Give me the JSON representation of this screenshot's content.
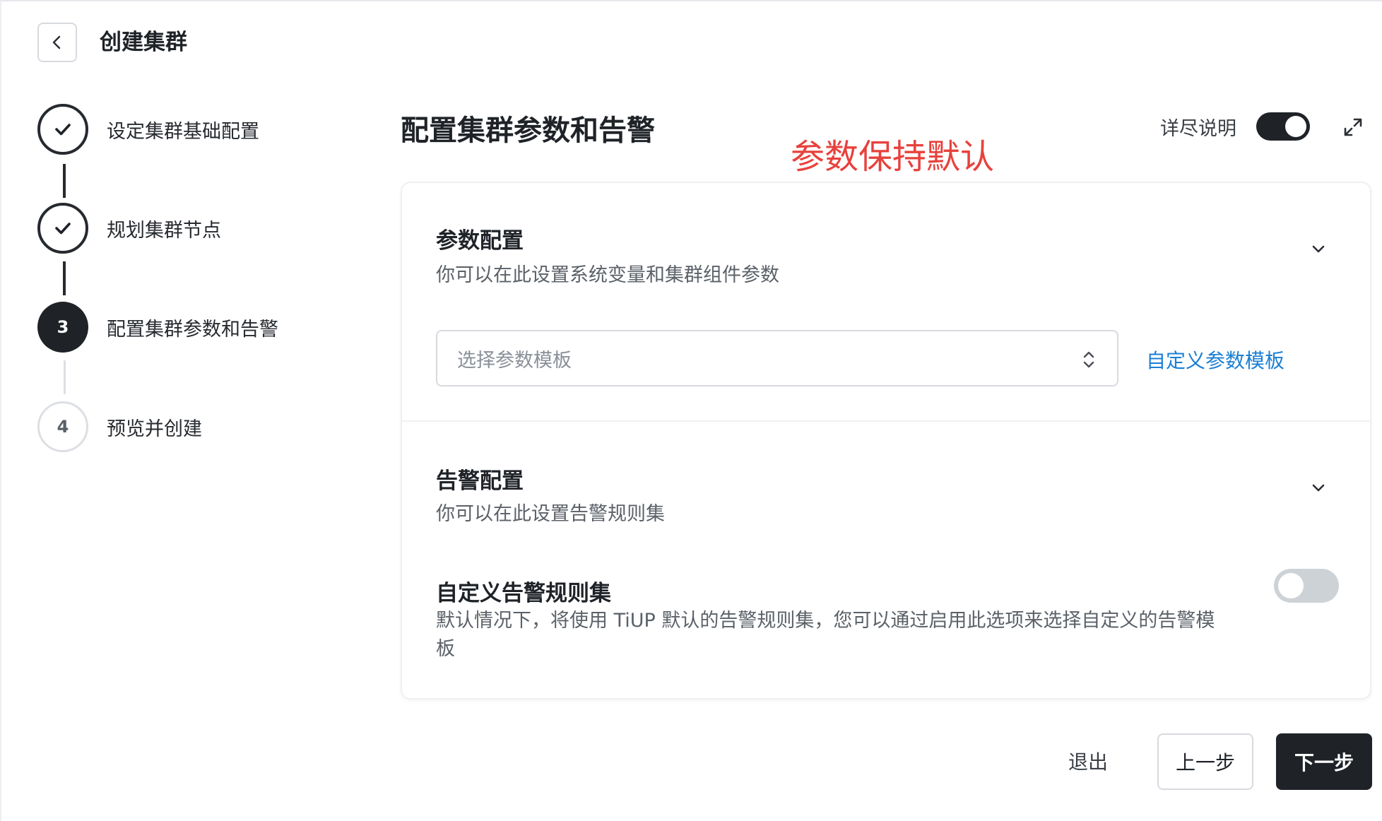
{
  "header": {
    "title": "创建集群",
    "back_icon": "chevron-left-icon"
  },
  "stepper": {
    "steps": [
      {
        "number": "",
        "label": "设定集群基础配置",
        "status": "done"
      },
      {
        "number": "",
        "label": "规划集群节点",
        "status": "done"
      },
      {
        "number": "3",
        "label": "配置集群参数和告警",
        "status": "active"
      },
      {
        "number": "4",
        "label": "预览并创建",
        "status": "pending"
      }
    ]
  },
  "main": {
    "title": "配置集群参数和告警",
    "annotation": "参数保持默认",
    "annotation_color": "#e8413c",
    "detail_toggle_label": "详尽说明",
    "detail_toggle_on": true
  },
  "param_section": {
    "title": "参数配置",
    "description": "你可以在此设置系统变量和集群组件参数",
    "select_placeholder": "选择参数模板",
    "custom_link": "自定义参数模板",
    "link_color": "#1a7fd4"
  },
  "alert_section": {
    "title": "告警配置",
    "description": "你可以在此设置告警规则集",
    "custom_title": "自定义告警规则集",
    "custom_desc": "默认情况下，将使用 TiUP 默认的告警规则集，您可以通过启用此选项来选择自定义的告警模板",
    "custom_toggle_on": false
  },
  "footer": {
    "exit_label": "退出",
    "prev_label": "上一步",
    "next_label": "下一步"
  }
}
